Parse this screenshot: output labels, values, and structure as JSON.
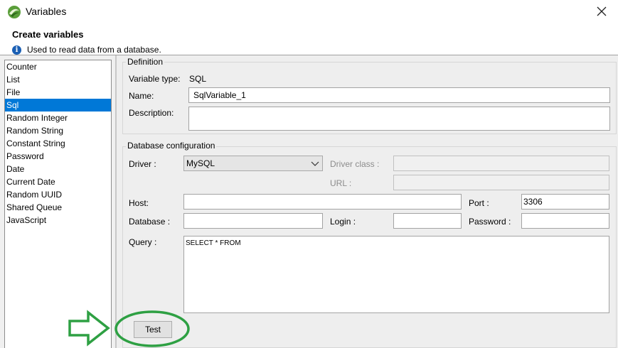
{
  "window": {
    "title": "Variables",
    "app_icon": "app-logo-icon",
    "close_icon": "close-icon"
  },
  "header": {
    "title": "Create variables",
    "info_icon": "info-icon",
    "info_glyph": "i",
    "info_text": "Used to read data from a database."
  },
  "variable_types": [
    {
      "label": "Counter",
      "selected": false
    },
    {
      "label": "List",
      "selected": false
    },
    {
      "label": "File",
      "selected": false
    },
    {
      "label": "Sql",
      "selected": true
    },
    {
      "label": "Random Integer",
      "selected": false
    },
    {
      "label": "Random String",
      "selected": false
    },
    {
      "label": "Constant String",
      "selected": false
    },
    {
      "label": "Password",
      "selected": false
    },
    {
      "label": "Date",
      "selected": false
    },
    {
      "label": "Current Date",
      "selected": false
    },
    {
      "label": "Random UUID",
      "selected": false
    },
    {
      "label": "Shared Queue",
      "selected": false
    },
    {
      "label": "JavaScript",
      "selected": false
    }
  ],
  "definition": {
    "group_title": "Definition",
    "variable_type_label": "Variable type:",
    "variable_type_value": "SQL",
    "name_label": "Name:",
    "name_value": "SqlVariable_1",
    "description_label": "Description:",
    "description_value": ""
  },
  "database": {
    "group_title": "Database configuration",
    "driver_label": "Driver :",
    "driver_value": "MySQL",
    "driver_class_label": "Driver class :",
    "driver_class_value": "",
    "url_label": "URL :",
    "url_value": "",
    "host_label": "Host:",
    "host_value": "",
    "port_label": "Port :",
    "port_value": "3306",
    "database_label": "Database :",
    "database_value": "",
    "login_label": "Login :",
    "login_value": "",
    "password_label": "Password :",
    "password_value": "",
    "query_label": "Query :",
    "query_value": "SELECT * FROM"
  },
  "actions": {
    "test_label": "Test"
  },
  "annotation": {
    "arrow_icon": "right-arrow-icon",
    "color": "#2ea043"
  },
  "colors": {
    "selection": "#0078d7",
    "panel": "#eeeeee",
    "info": "#1a5fb4"
  }
}
